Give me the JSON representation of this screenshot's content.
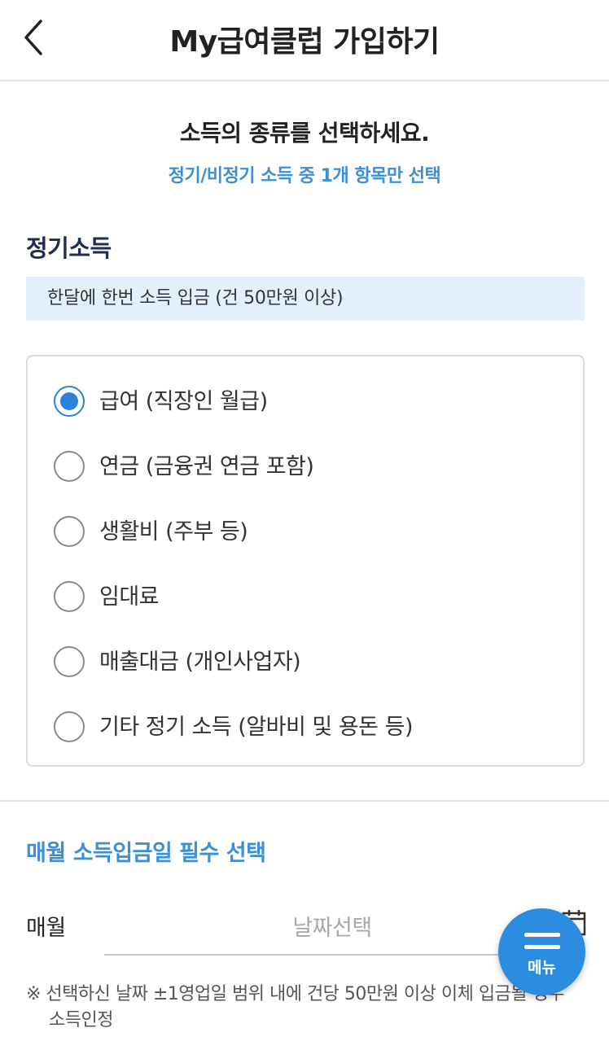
{
  "header": {
    "title": "My급여클럽 가입하기",
    "back_icon": "chevron-left-icon"
  },
  "intro": {
    "title": "소득의 종류를 선택하세요.",
    "subtitle": "정기/비정기 소득 중 1개 항목만 선택"
  },
  "regular_income": {
    "title": "정기소득",
    "info": "한달에 한번 소득 입금 (건 50만원 이상)",
    "options": [
      {
        "label": "급여 (직장인 월급)",
        "checked": true
      },
      {
        "label": "연금 (금융권 연금 포함)",
        "checked": false
      },
      {
        "label": "생활비 (주부 등)",
        "checked": false
      },
      {
        "label": "임대료",
        "checked": false
      },
      {
        "label": "매출대금 (개인사업자)",
        "checked": false
      },
      {
        "label": "기타 정기 소득 (알바비 및 용돈 등)",
        "checked": false
      }
    ]
  },
  "deposit_date": {
    "title": "매월 소득입금일 필수 선택",
    "label": "매월",
    "placeholder": "날짜선택",
    "icon": "calendar-icon",
    "notice": "※ 선택하신 날짜 ±1영업일 범위 내에 건당 50만원 이상 이체 입금될 경우 소득인정"
  },
  "menu_button": {
    "label": "메뉴",
    "icon": "menu-icon"
  },
  "colors": {
    "accent": "#2a83d8",
    "info_bg": "#e3f0fc",
    "section_title": "#1f2d4e"
  }
}
